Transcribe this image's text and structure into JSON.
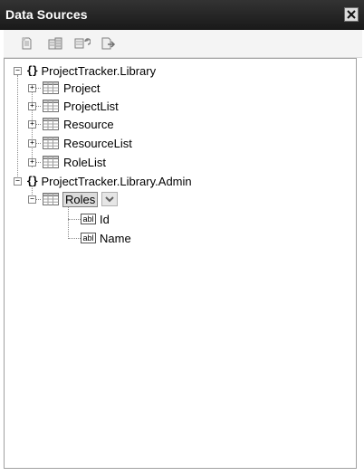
{
  "window": {
    "title": "Data Sources",
    "close_label": "×"
  },
  "toolbar": {
    "buttons": [
      {
        "name": "add-new-data-source-button",
        "icon": "database-add-icon"
      },
      {
        "name": "edit-dataset-button",
        "icon": "dataset-designer-icon"
      },
      {
        "name": "configure-dataset-button",
        "icon": "configure-icon"
      },
      {
        "name": "refresh-button",
        "icon": "refresh-icon"
      }
    ]
  },
  "tree": {
    "namespaces": [
      {
        "label": "ProjectTracker.Library",
        "expander": "−",
        "classes": [
          {
            "label": "Project",
            "expander": "+"
          },
          {
            "label": "ProjectList",
            "expander": "+"
          },
          {
            "label": "Resource",
            "expander": "+"
          },
          {
            "label": "ResourceList",
            "expander": "+"
          },
          {
            "label": "RoleList",
            "expander": "+"
          }
        ]
      },
      {
        "label": "ProjectTracker.Library.Admin",
        "expander": "−",
        "classes": [
          {
            "label": "Roles",
            "expander": "−",
            "selected": true,
            "fields": [
              {
                "label": "Id",
                "type_icon": "abl"
              },
              {
                "label": "Name",
                "type_icon": "abl"
              }
            ]
          }
        ]
      }
    ]
  },
  "colors": {
    "titlebar": "#222222",
    "selection": "#dcdcdc"
  }
}
